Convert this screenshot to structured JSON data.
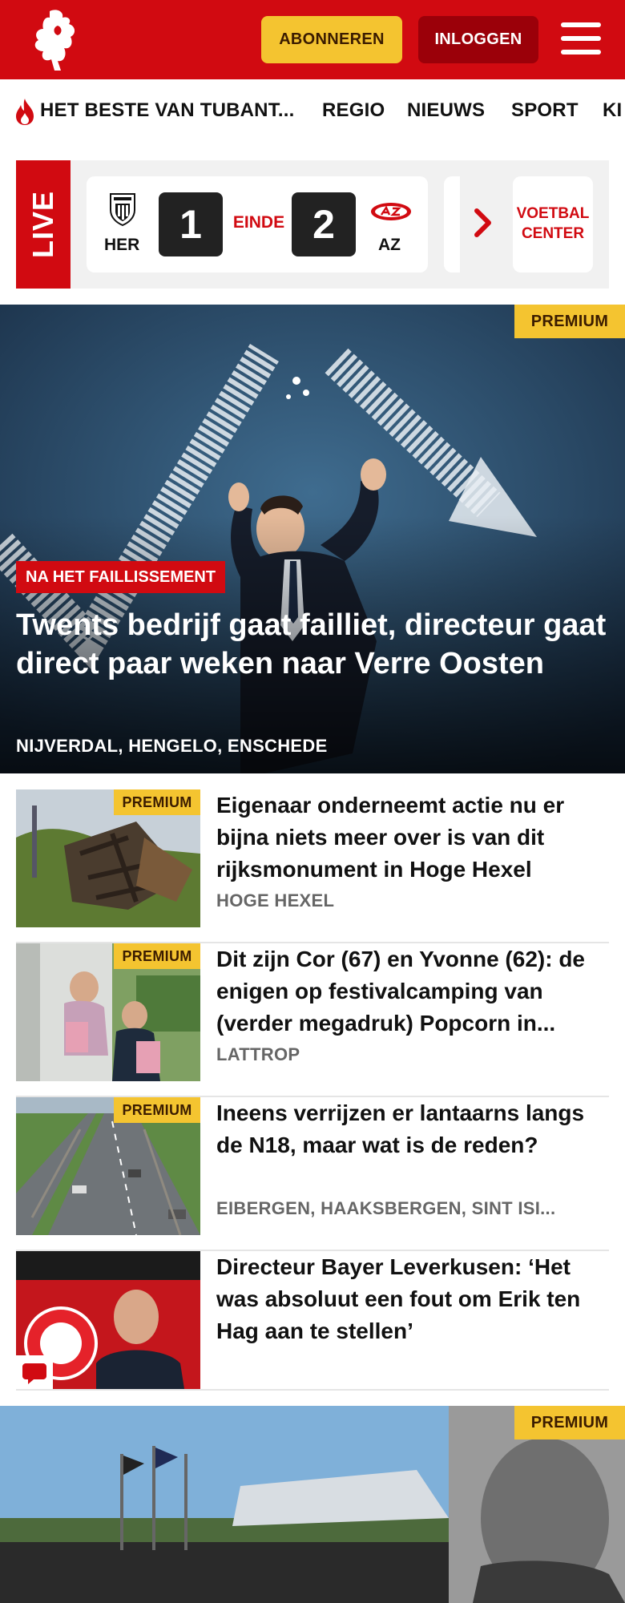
{
  "header": {
    "subscribe_label": "ABONNEREN",
    "login_label": "INLOGGEN"
  },
  "nav": {
    "items": [
      {
        "label": "HET BESTE VAN TUBANT..."
      },
      {
        "label": "REGIO"
      },
      {
        "label": "NIEUWS"
      },
      {
        "label": "SPORT"
      },
      {
        "label": "KI"
      }
    ]
  },
  "live": {
    "label": "LIVE",
    "match": {
      "home_code": "HER",
      "away_code": "AZ",
      "home_score": "1",
      "away_score": "2",
      "status": "EINDE"
    },
    "voetbal_center": "VOETBAL CENTER"
  },
  "hero": {
    "badge": "PREMIUM",
    "kicker": "NA HET FAILLISSEMENT",
    "title": "Twents bedrijf gaat failliet, directeur gaat direct paar weken naar Verre Oosten",
    "locations": "NIJVERDAL, HENGELO, ENSCHEDE"
  },
  "articles": [
    {
      "badge": "PREMIUM",
      "title": "Eigenaar onderneemt actie nu er bijna niets meer over is van dit rijksmonument in Hoge Hexel",
      "location": "HOGE HEXEL"
    },
    {
      "badge": "PREMIUM",
      "title": "Dit zijn Cor (67) en Yvonne (62): de enigen op festivalcamping van (verder megadruk) Popcorn in...",
      "location": "LATTROP"
    },
    {
      "badge": "PREMIUM",
      "title": "Ineens verrijzen er lantaarns langs de N18, maar wat is de reden?",
      "location": "EIBERGEN, HAAKSBERGEN, SINT ISI..."
    },
    {
      "badge": "",
      "title": "Directeur Bayer Leverkusen: ‘Het was absoluut een fout om Erik ten Hag aan te stellen’",
      "location": ""
    }
  ],
  "hero2": {
    "badge": "PREMIUM"
  },
  "colors": {
    "brand_red": "#d10a11",
    "premium_yellow": "#f4c430",
    "login_dark_red": "#9b0009"
  }
}
